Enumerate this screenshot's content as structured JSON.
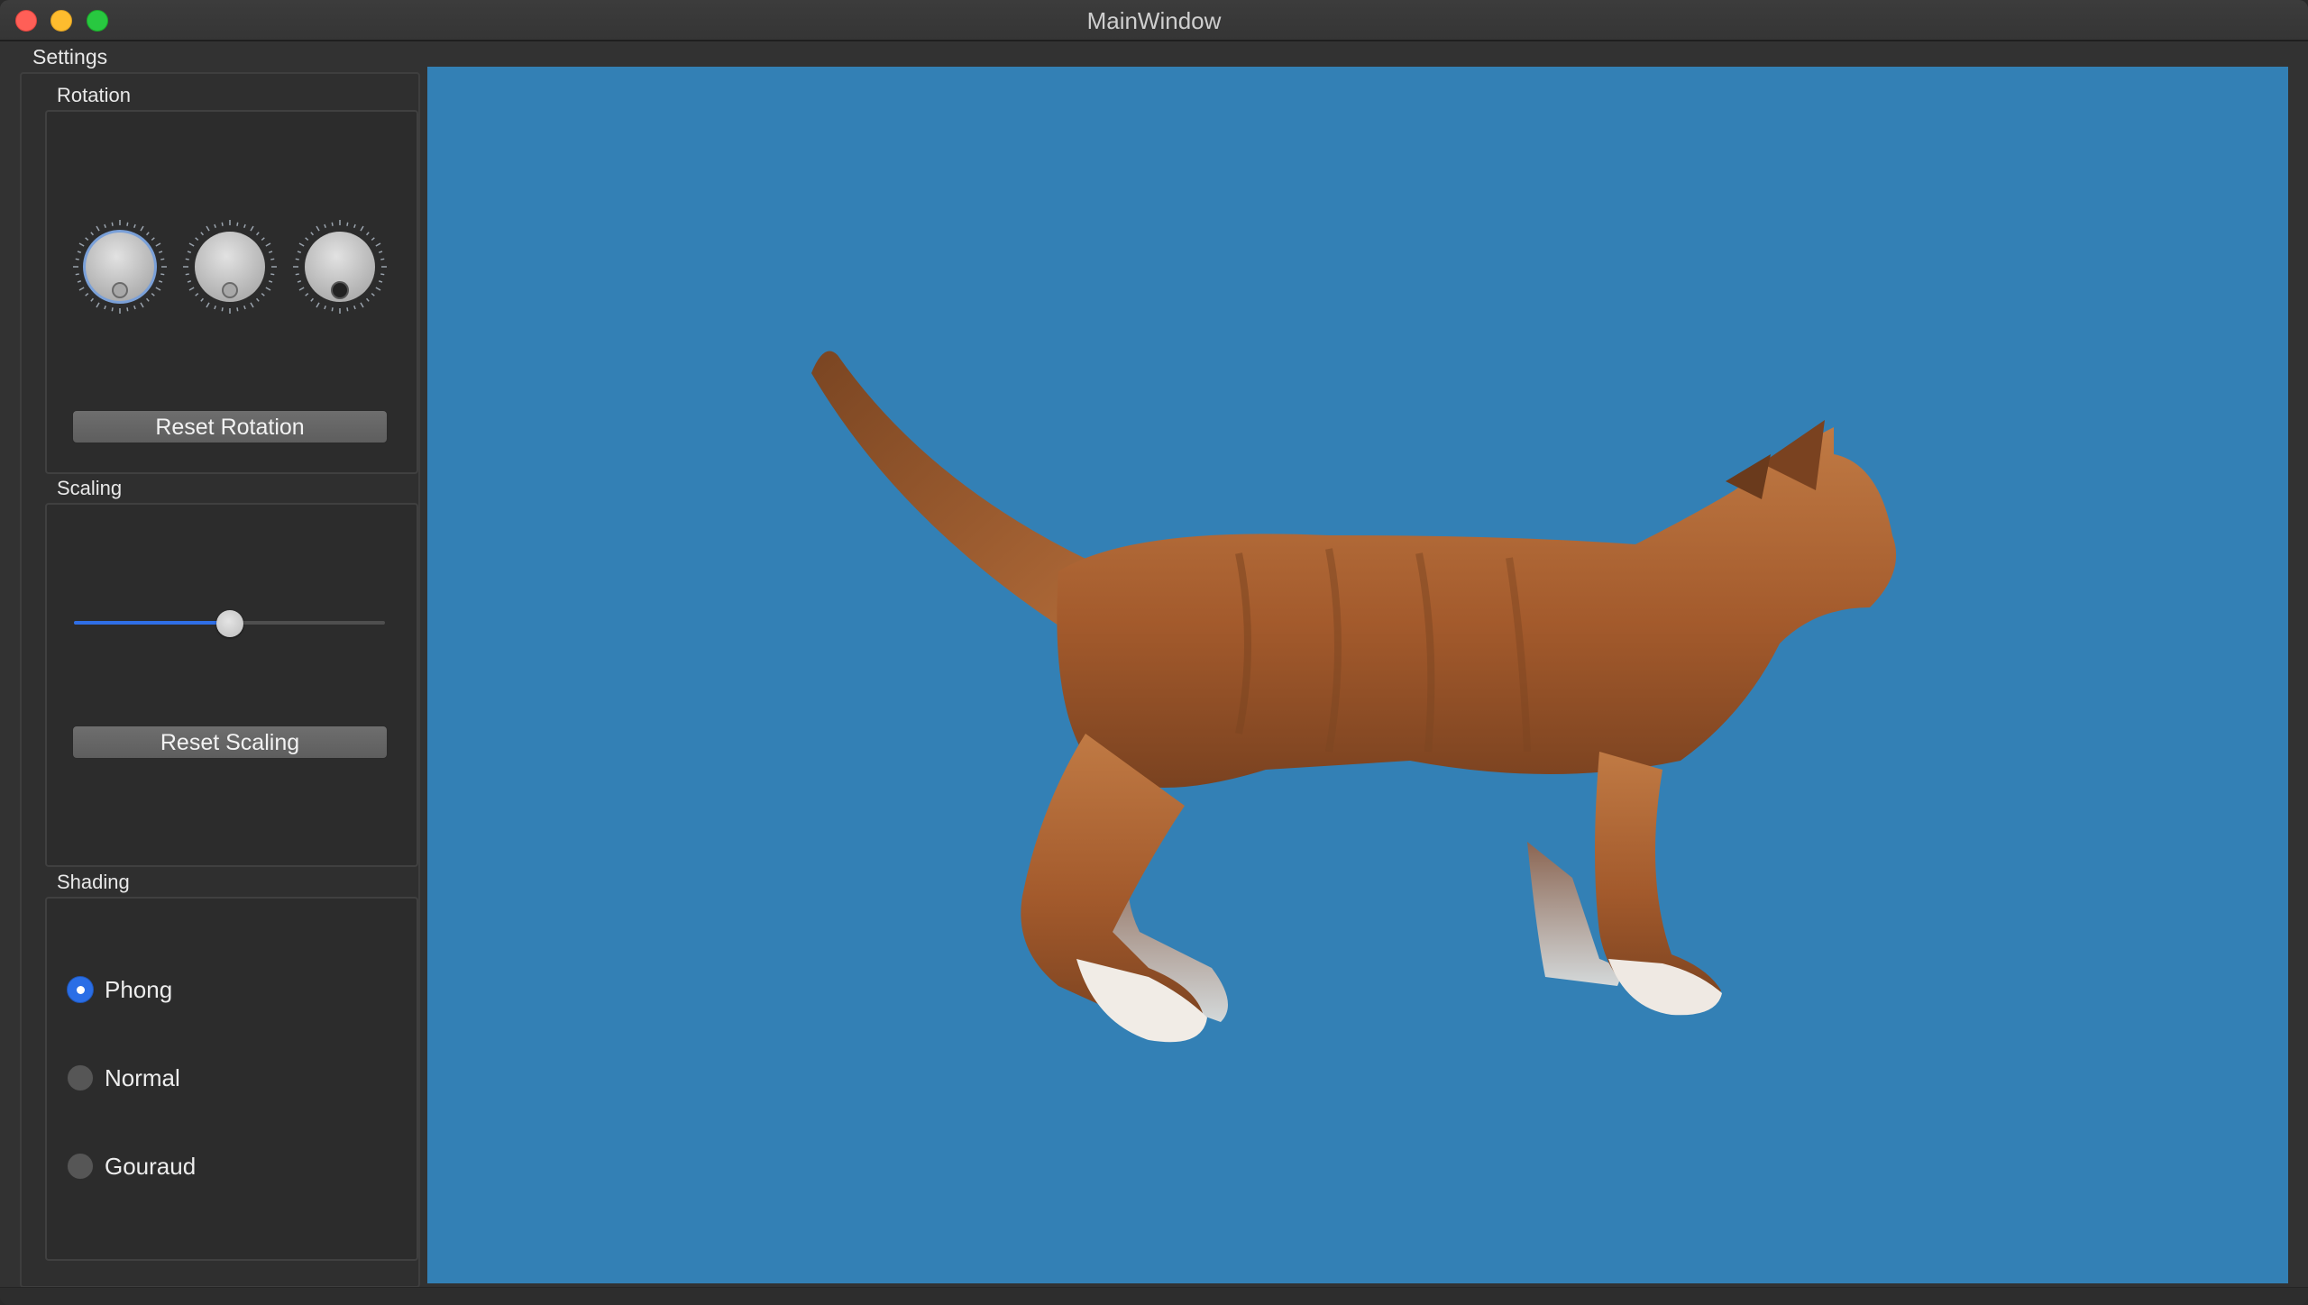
{
  "window": {
    "title": "MainWindow"
  },
  "settings": {
    "label": "Settings"
  },
  "rotation": {
    "title": "Rotation",
    "dials": [
      {
        "name": "x",
        "focused": true
      },
      {
        "name": "y",
        "focused": false
      },
      {
        "name": "z",
        "focused": false
      }
    ],
    "reset_label": "Reset Rotation"
  },
  "scaling": {
    "title": "Scaling",
    "slider_value": 0.5,
    "reset_label": "Reset Scaling"
  },
  "shading": {
    "title": "Shading",
    "options": [
      {
        "label": "Phong",
        "checked": true
      },
      {
        "label": "Normal",
        "checked": false
      },
      {
        "label": "Gouraud",
        "checked": false
      }
    ]
  },
  "viewport": {
    "background": "#3380b5",
    "model": "cat-model-icon"
  },
  "colors": {
    "accent": "#2a6ee6",
    "close": "#ff5f57",
    "minimize": "#febc2e",
    "maximize": "#28c840"
  }
}
